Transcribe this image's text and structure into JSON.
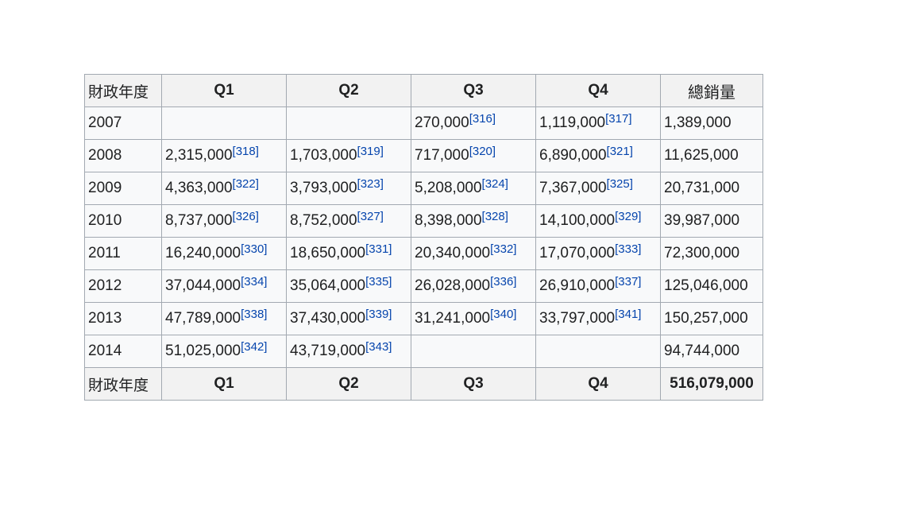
{
  "header": {
    "year_label": "財政年度",
    "q1": "Q1",
    "q2": "Q2",
    "q3": "Q3",
    "q4": "Q4",
    "total_label": "總銷量"
  },
  "rows": [
    {
      "year": "2007",
      "q1": "",
      "q1_ref": "",
      "q2": "",
      "q2_ref": "",
      "q3": "270,000",
      "q3_ref": "[316]",
      "q4": "1,119,000",
      "q4_ref": "[317]",
      "total": "1,389,000"
    },
    {
      "year": "2008",
      "q1": "2,315,000",
      "q1_ref": "[318]",
      "q2": "1,703,000",
      "q2_ref": "[319]",
      "q3": "717,000",
      "q3_ref": "[320]",
      "q4": "6,890,000",
      "q4_ref": "[321]",
      "total": "11,625,000"
    },
    {
      "year": "2009",
      "q1": "4,363,000",
      "q1_ref": "[322]",
      "q2": "3,793,000",
      "q2_ref": "[323]",
      "q3": "5,208,000",
      "q3_ref": "[324]",
      "q4": "7,367,000",
      "q4_ref": "[325]",
      "total": "20,731,000"
    },
    {
      "year": "2010",
      "q1": "8,737,000",
      "q1_ref": "[326]",
      "q2": "8,752,000",
      "q2_ref": "[327]",
      "q3": "8,398,000",
      "q3_ref": "[328]",
      "q4": "14,100,000",
      "q4_ref": "[329]",
      "total": "39,987,000"
    },
    {
      "year": "2011",
      "q1": "16,240,000",
      "q1_ref": "[330]",
      "q2": "18,650,000",
      "q2_ref": "[331]",
      "q3": "20,340,000",
      "q3_ref": "[332]",
      "q4": "17,070,000",
      "q4_ref": "[333]",
      "total": "72,300,000"
    },
    {
      "year": "2012",
      "q1": "37,044,000",
      "q1_ref": "[334]",
      "q2": "35,064,000",
      "q2_ref": "[335]",
      "q3": "26,028,000",
      "q3_ref": "[336]",
      "q4": "26,910,000",
      "q4_ref": "[337]",
      "total": "125,046,000"
    },
    {
      "year": "2013",
      "q1": "47,789,000",
      "q1_ref": "[338]",
      "q2": "37,430,000",
      "q2_ref": "[339]",
      "q3": "31,241,000",
      "q3_ref": "[340]",
      "q4": "33,797,000",
      "q4_ref": "[341]",
      "total": "150,257,000"
    },
    {
      "year": "2014",
      "q1": "51,025,000",
      "q1_ref": "[342]",
      "q2": "43,719,000",
      "q2_ref": "[343]",
      "q3": "",
      "q3_ref": "",
      "q4": "",
      "q4_ref": "",
      "total": "94,744,000"
    }
  ],
  "footer": {
    "year_label": "財政年度",
    "q1": "Q1",
    "q2": "Q2",
    "q3": "Q3",
    "q4": "Q4",
    "grand_total": "516,079,000"
  },
  "colors": {
    "link": "#0645ad",
    "border": "#a2a9b1",
    "header_bg": "#f2f2f2",
    "cell_bg": "#f8f9fa"
  }
}
